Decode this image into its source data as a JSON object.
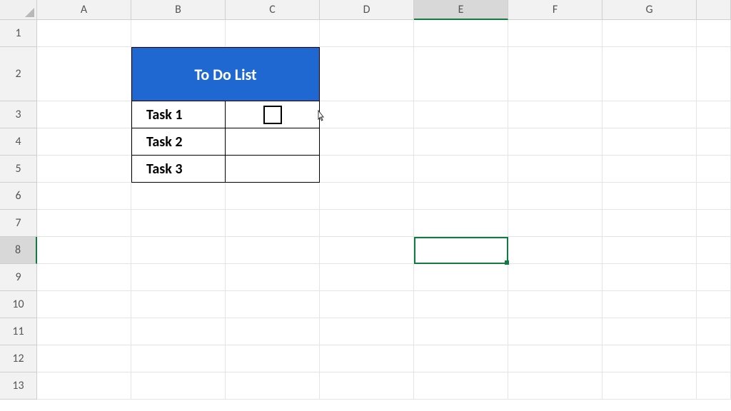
{
  "columns": [
    "A",
    "B",
    "C",
    "D",
    "E",
    "F",
    "G"
  ],
  "rows": [
    "1",
    "2",
    "3",
    "4",
    "5",
    "6",
    "7",
    "8",
    "9",
    "10",
    "11",
    "12",
    "13"
  ],
  "selected_column": "E",
  "selected_row": "8",
  "todo": {
    "title": "To Do List",
    "tasks": [
      "Task 1",
      "Task 2",
      "Task 3"
    ]
  },
  "colors": {
    "header_bg": "#1f68d1",
    "header_fg": "#ffffff",
    "selection_border": "#107c41"
  }
}
